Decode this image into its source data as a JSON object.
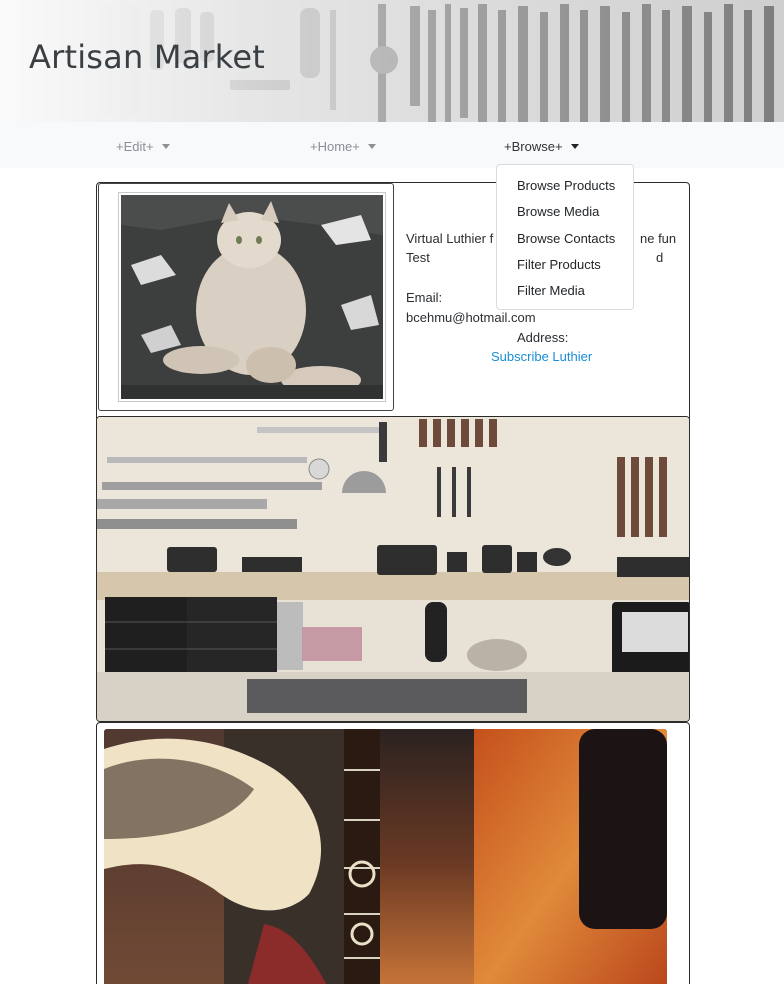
{
  "header": {
    "title": "Artisan Market"
  },
  "navbar": {
    "items": [
      {
        "label": "+Edit+"
      },
      {
        "label": "+Home+"
      },
      {
        "label": "+Browse+"
      }
    ]
  },
  "dropdown": {
    "items": [
      "Browse Products",
      "Browse Media",
      "Browse Contacts",
      "Filter Products",
      "Filter Media"
    ]
  },
  "profile": {
    "description_line1": "Virtual Luthier f",
    "description_line1_right": "ne fun",
    "description_line2": "Test",
    "description_line2_right": "d",
    "email_label": "Email:",
    "email": "bcehmu@hotmail.com",
    "address_label": "Address:",
    "subscribe_label": "Subscribe Luthier"
  },
  "colors": {
    "accent_link": "#1a8cd8",
    "navbar_bg": "#f8f9fa",
    "title": "#3a3f44"
  }
}
